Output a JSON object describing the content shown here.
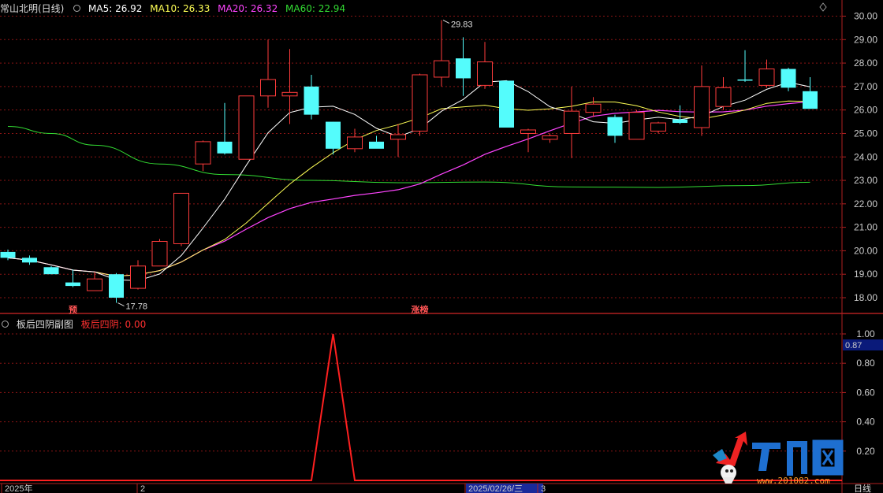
{
  "header": {
    "stock_name": "常山北明(日线)",
    "ma5": "MA5: 26.92",
    "ma10": "MA10: 26.33",
    "ma20": "MA20: 26.32",
    "ma60": "MA60: 22.94"
  },
  "sub_header": {
    "indicator_name": "板后四阴副图",
    "value_label": "板后四阴: 0.00"
  },
  "colors": {
    "up": "#ff3c3c",
    "down": "#54fcfc",
    "ma5": "#ffffff",
    "ma10": "#ffff55",
    "ma20": "#ff44ff",
    "ma60": "#33dd33",
    "grid": "#8b1414",
    "axis": "#b02020",
    "indicator": "#ff2020"
  },
  "chart_data": {
    "type": "candlestick",
    "price_axis": {
      "ticks": [
        "30.00",
        "29.00",
        "28.00",
        "27.00",
        "26.00",
        "25.00",
        "24.00",
        "23.00",
        "22.00",
        "21.00",
        "20.00",
        "19.00",
        "18.00"
      ],
      "range": [
        17.2,
        30.3
      ]
    },
    "candles": [
      {
        "o": 19.95,
        "h": 20.05,
        "l": 19.6,
        "c": 19.7
      },
      {
        "o": 19.7,
        "h": 19.8,
        "l": 19.4,
        "c": 19.5
      },
      {
        "o": 19.3,
        "h": 19.35,
        "l": 19.0,
        "c": 19.0
      },
      {
        "o": 18.65,
        "h": 19.2,
        "l": 18.45,
        "c": 18.5
      },
      {
        "o": 18.3,
        "h": 19.1,
        "l": 18.3,
        "c": 18.8
      },
      {
        "o": 19.0,
        "h": 19.05,
        "l": 17.78,
        "c": 18.0
      },
      {
        "o": 18.4,
        "h": 19.6,
        "l": 18.35,
        "c": 19.35
      },
      {
        "o": 19.35,
        "h": 20.5,
        "l": 19.35,
        "c": 20.4
      },
      {
        "o": 20.3,
        "h": 22.45,
        "l": 20.2,
        "c": 22.45
      },
      {
        "o": 23.7,
        "h": 24.7,
        "l": 23.4,
        "c": 24.65
      },
      {
        "o": 24.65,
        "h": 26.3,
        "l": 24.1,
        "c": 24.15
      },
      {
        "o": 23.9,
        "h": 26.6,
        "l": 23.9,
        "c": 26.6
      },
      {
        "o": 26.6,
        "h": 29.0,
        "l": 26.1,
        "c": 27.3
      },
      {
        "o": 26.6,
        "h": 28.6,
        "l": 25.4,
        "c": 26.75
      },
      {
        "o": 27.0,
        "h": 27.5,
        "l": 25.6,
        "c": 25.8
      },
      {
        "o": 25.5,
        "h": 25.5,
        "l": 24.1,
        "c": 24.35
      },
      {
        "o": 24.35,
        "h": 25.2,
        "l": 24.2,
        "c": 24.85
      },
      {
        "o": 24.65,
        "h": 24.9,
        "l": 24.4,
        "c": 24.35
      },
      {
        "o": 24.75,
        "h": 25.4,
        "l": 24.0,
        "c": 24.95
      },
      {
        "o": 25.1,
        "h": 27.55,
        "l": 24.9,
        "c": 27.5
      },
      {
        "o": 27.4,
        "h": 29.83,
        "l": 27.0,
        "c": 28.1
      },
      {
        "o": 28.2,
        "h": 29.1,
        "l": 26.6,
        "c": 27.35
      },
      {
        "o": 27.05,
        "h": 28.9,
        "l": 26.9,
        "c": 28.05
      },
      {
        "o": 27.25,
        "h": 27.25,
        "l": 25.25,
        "c": 25.25
      },
      {
        "o": 25.0,
        "h": 25.2,
        "l": 24.2,
        "c": 25.15
      },
      {
        "o": 24.75,
        "h": 25.0,
        "l": 24.6,
        "c": 24.9
      },
      {
        "o": 25.0,
        "h": 27.0,
        "l": 23.95,
        "c": 25.95
      },
      {
        "o": 25.9,
        "h": 26.55,
        "l": 25.7,
        "c": 26.25
      },
      {
        "o": 25.7,
        "h": 25.8,
        "l": 24.6,
        "c": 24.9
      },
      {
        "o": 24.75,
        "h": 26.0,
        "l": 24.75,
        "c": 25.9
      },
      {
        "o": 25.1,
        "h": 25.5,
        "l": 25.0,
        "c": 25.45
      },
      {
        "o": 25.6,
        "h": 26.2,
        "l": 25.4,
        "c": 25.45
      },
      {
        "o": 25.25,
        "h": 27.9,
        "l": 24.9,
        "c": 27.0
      },
      {
        "o": 26.15,
        "h": 27.4,
        "l": 26.0,
        "c": 26.95
      },
      {
        "o": 27.3,
        "h": 28.55,
        "l": 27.2,
        "c": 27.25
      },
      {
        "o": 27.05,
        "h": 28.15,
        "l": 26.95,
        "c": 27.75
      },
      {
        "o": 27.75,
        "h": 27.8,
        "l": 26.8,
        "c": 26.95
      },
      {
        "o": 26.8,
        "h": 27.4,
        "l": 26.05,
        "c": 26.05
      }
    ],
    "ma60": [
      [
        0,
        25.3
      ],
      [
        2,
        25.0
      ],
      [
        4,
        24.5
      ],
      [
        7,
        23.7
      ],
      [
        10,
        23.25
      ],
      [
        14,
        23.0
      ],
      [
        18,
        22.9
      ],
      [
        22,
        22.93
      ],
      [
        26,
        22.72
      ],
      [
        30,
        22.7
      ],
      [
        34,
        22.78
      ],
      [
        37,
        22.92
      ]
    ],
    "annotations": {
      "low": "17.78",
      "high": "29.83"
    },
    "markers": [
      {
        "index": 3,
        "text": "预"
      },
      {
        "index": 19,
        "text": "涨榜"
      }
    ],
    "indicator": {
      "axis_ticks": [
        "1.00",
        "0.80",
        "0.60",
        "0.40",
        "0.20"
      ],
      "current_value": "0.87",
      "spike_index": 15,
      "values_note": "0 everywhere except 1.00 at one day"
    },
    "time_axis": [
      "2025年",
      "2",
      "2025/02/26/三",
      "3"
    ],
    "period_label": "日线"
  }
}
